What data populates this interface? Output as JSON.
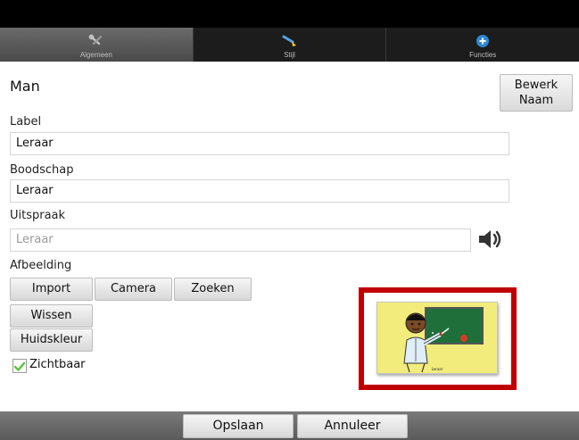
{
  "tabs": [
    {
      "label": "Algemeen",
      "icon": "wrench-screwdriver-icon",
      "active": true
    },
    {
      "label": "Stijl",
      "icon": "paint-brush-icon",
      "active": false
    },
    {
      "label": "Functies",
      "icon": "plus-circle-icon",
      "active": false
    }
  ],
  "title": "Man",
  "edit_name_button": {
    "line1": "Bewerk",
    "line2": "Naam"
  },
  "fields": {
    "label": {
      "caption": "Label",
      "value": "Leraar"
    },
    "message": {
      "caption": "Boodschap",
      "value": "Leraar"
    },
    "pronunciation": {
      "caption": "Uitspraak",
      "value": "Leraar"
    }
  },
  "image_section": {
    "caption": "Afbeelding",
    "buttons": {
      "import": "Import",
      "camera": "Camera",
      "search": "Zoeken",
      "clear": "Wissen",
      "skin_color": "Huidskleur"
    },
    "symbol_caption": "Leraar"
  },
  "visible_checkbox": {
    "label": "Zichtbaar",
    "checked": true
  },
  "footer": {
    "save": "Opslaan",
    "cancel": "Annuleer"
  },
  "colors": {
    "accent_check": "#56c43a",
    "highlight_frame": "#c00000",
    "tab_active": "#5a5a5a"
  }
}
